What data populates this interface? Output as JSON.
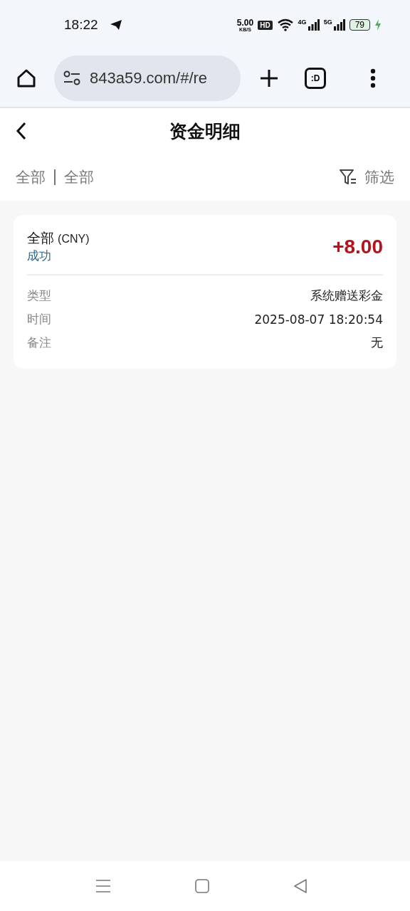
{
  "status_bar": {
    "time": "18:22",
    "speed": "5.00",
    "speed_unit": "KB/S",
    "hd": "HD",
    "net1": "4G",
    "net2": "5G",
    "battery": "79",
    "charging": true
  },
  "browser": {
    "url": "843a59.com/#/re",
    "tab_label": ":D"
  },
  "header": {
    "title": "资金明细"
  },
  "filters": {
    "items": [
      "全部",
      "全部"
    ],
    "filter_label": "筛选"
  },
  "records": [
    {
      "title": "全部",
      "currency": "(CNY)",
      "status": "成功",
      "amount": "+8.00",
      "details": [
        {
          "label": "类型",
          "value": "系统赠送彩金"
        },
        {
          "label": "时间",
          "value": "2025-08-07 18:20:54"
        },
        {
          "label": "备注",
          "value": "无"
        }
      ]
    }
  ]
}
